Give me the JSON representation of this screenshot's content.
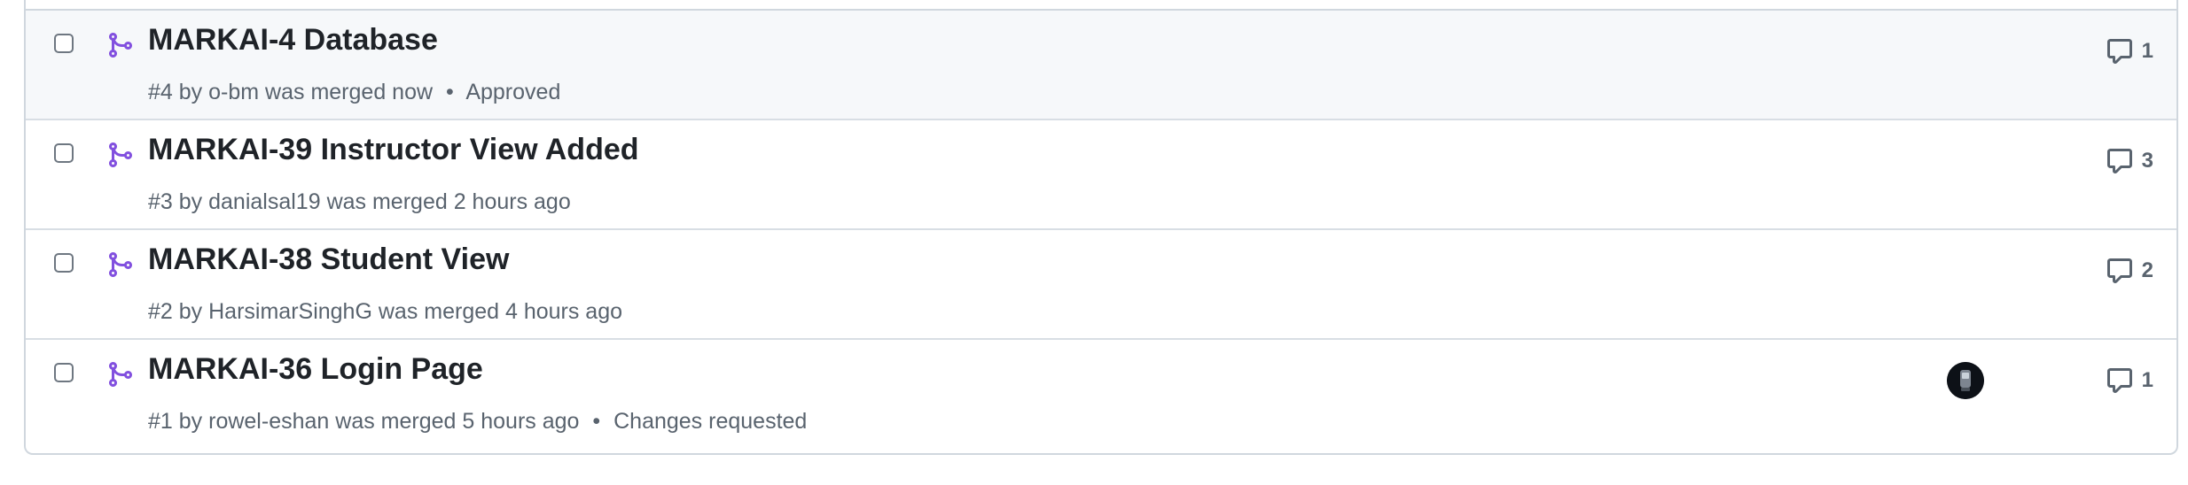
{
  "pull_requests": [
    {
      "title": "MARKAI-4 Database",
      "number": "#4",
      "by": "by",
      "author": "o-bm",
      "status_text": "was merged now",
      "separator": "•",
      "review": "Approved",
      "comments": "1",
      "has_avatar": false
    },
    {
      "title": "MARKAI-39 Instructor View Added",
      "number": "#3",
      "by": "by",
      "author": "danialsal19",
      "status_text": "was merged 2 hours ago",
      "separator": "",
      "review": "",
      "comments": "3",
      "has_avatar": false
    },
    {
      "title": "MARKAI-38 Student View",
      "number": "#2",
      "by": "by",
      "author": "HarsimarSinghG",
      "status_text": "was merged 4 hours ago",
      "separator": "",
      "review": "",
      "comments": "2",
      "has_avatar": false
    },
    {
      "title": "MARKAI-36 Login Page",
      "number": "#1",
      "by": "by",
      "author": "rowel-eshan",
      "status_text": "was merged 5 hours ago",
      "separator": "•",
      "review": "Changes requested",
      "comments": "1",
      "has_avatar": true
    }
  ],
  "colors": {
    "merged": "#8250df",
    "muted": "#59636e",
    "border": "#d0d7de"
  },
  "icons": {
    "merged": "git-merge-icon",
    "comment": "comment-icon"
  }
}
